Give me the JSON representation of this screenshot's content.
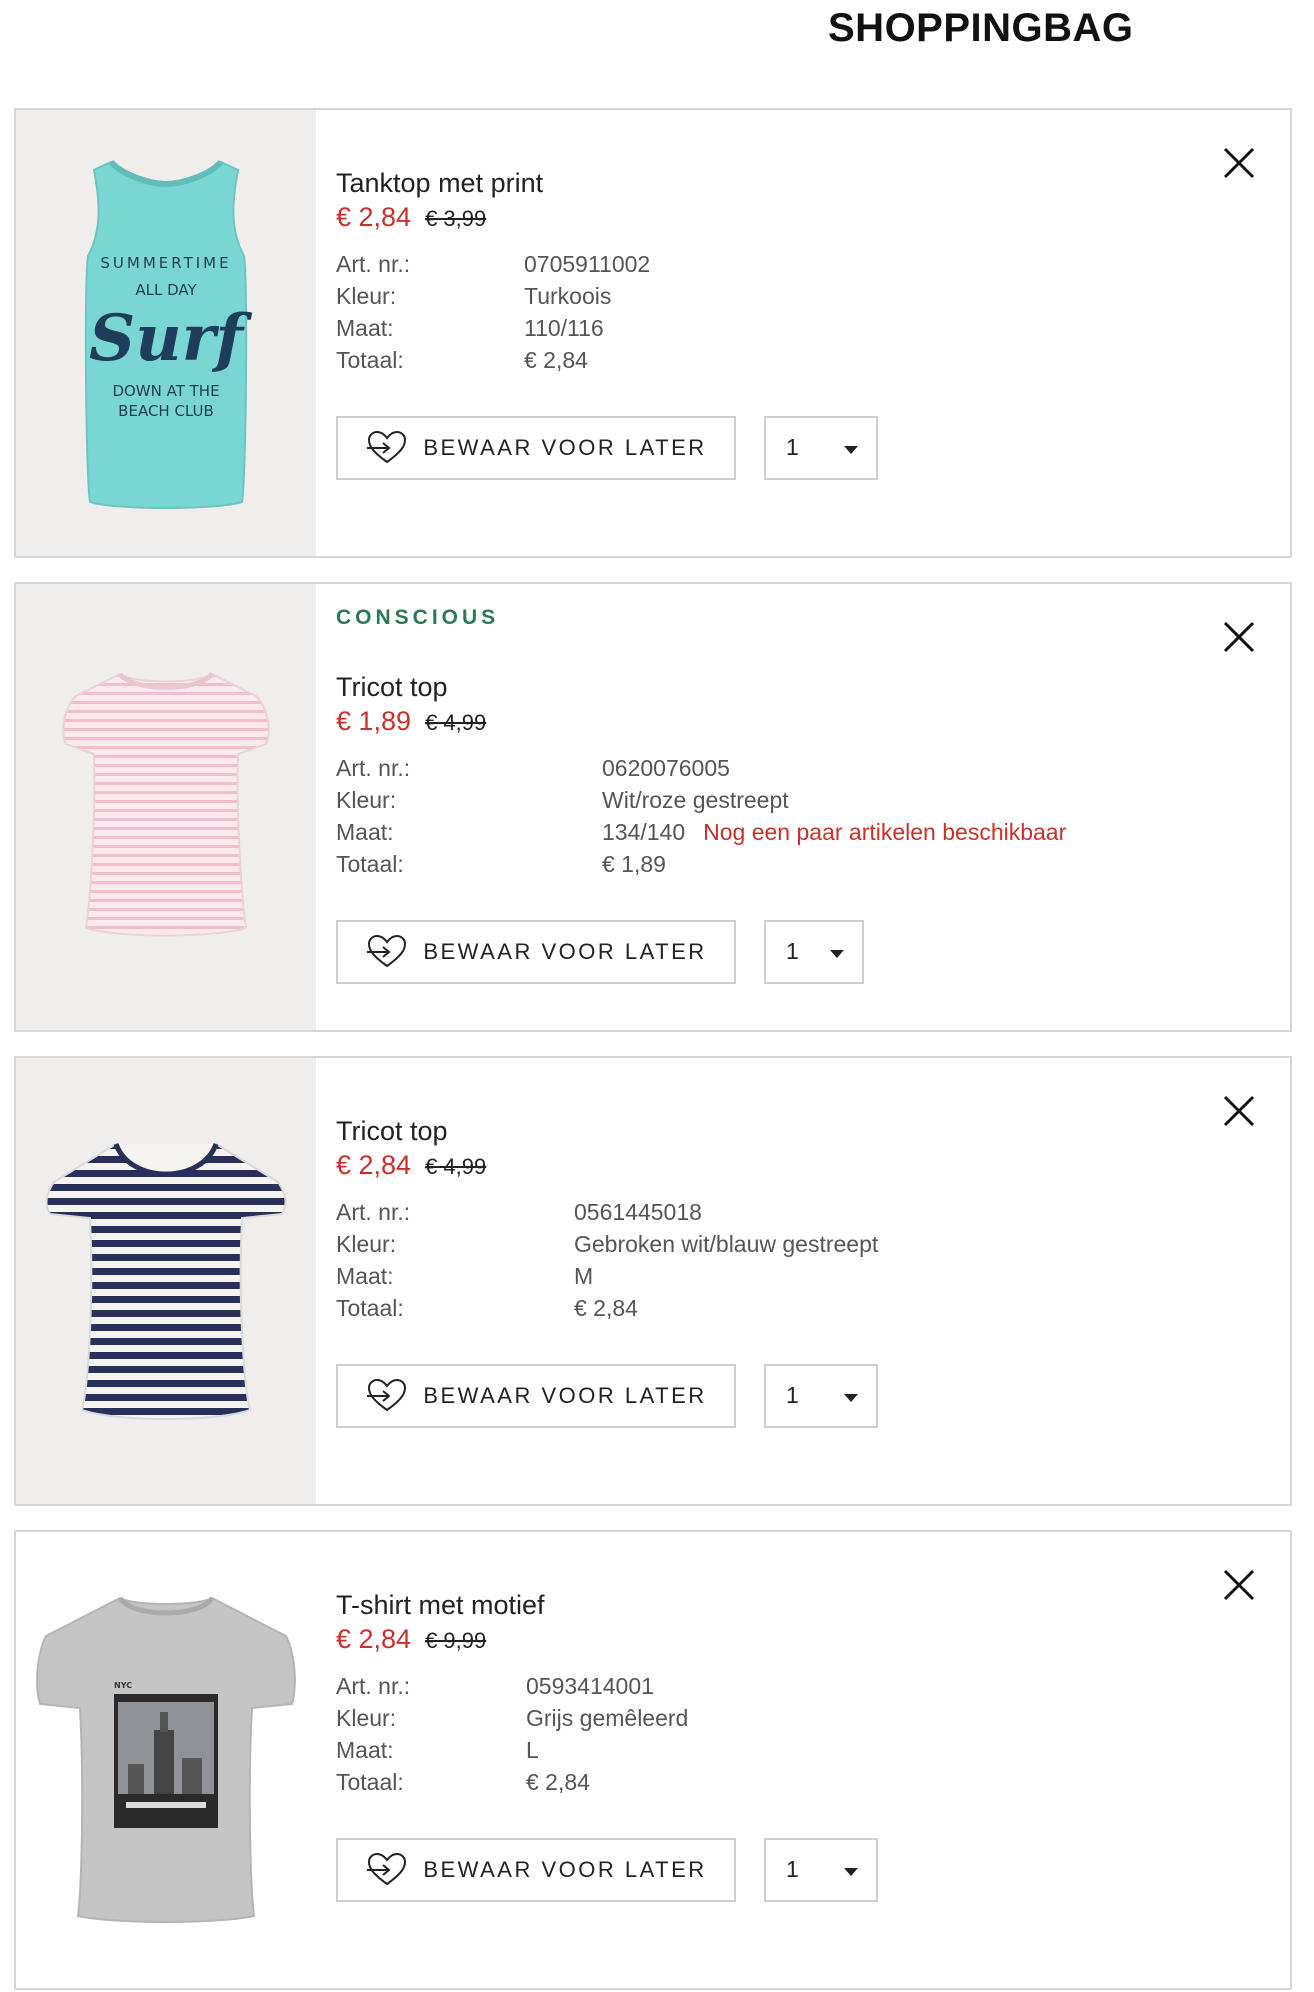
{
  "header": {
    "title": "SHOPPINGBAG"
  },
  "labels": {
    "art": "Art. nr.:",
    "color": "Kleur:",
    "size": "Maat:",
    "total": "Totaal:",
    "save": "BEWAAR VOOR LATER"
  },
  "items": [
    {
      "name": "Tanktop met print",
      "price": "€ 2,84",
      "old_price": "€ 3,99",
      "art_nr": "0705911002",
      "color": "Turkoois",
      "size": "110/116",
      "total": "€ 2,84",
      "qty": "1",
      "print_lines": [
        "SUMMERTIME",
        "ALL DAY",
        "Surf",
        "DOWN AT THE",
        "BEACH CLUB"
      ]
    },
    {
      "badge": "CONSCIOUS",
      "name": "Tricot top",
      "price": "€ 1,89",
      "old_price": "€ 4,99",
      "art_nr": "0620076005",
      "color": "Wit/roze gestreept",
      "size": "134/140",
      "stock_note": "Nog een paar artikelen beschikbaar",
      "total": "€ 1,89",
      "qty": "1"
    },
    {
      "name": "Tricot top",
      "price": "€ 2,84",
      "old_price": "€ 4,99",
      "art_nr": "0561445018",
      "color": "Gebroken wit/blauw gestreept",
      "size": "M",
      "total": "€ 2,84",
      "qty": "1"
    },
    {
      "name": "T-shirt met motief",
      "price": "€ 2,84",
      "old_price": "€ 9,99",
      "art_nr": "0593414001",
      "color": "Grijs gemêleerd",
      "size": "L",
      "total": "€ 2,84",
      "qty": "1",
      "print_lines": [
        "NYC"
      ]
    }
  ],
  "colors": {
    "sale_red": "#c8312b",
    "conscious_green": "#2a7a52",
    "border": "#d6d6d6"
  }
}
